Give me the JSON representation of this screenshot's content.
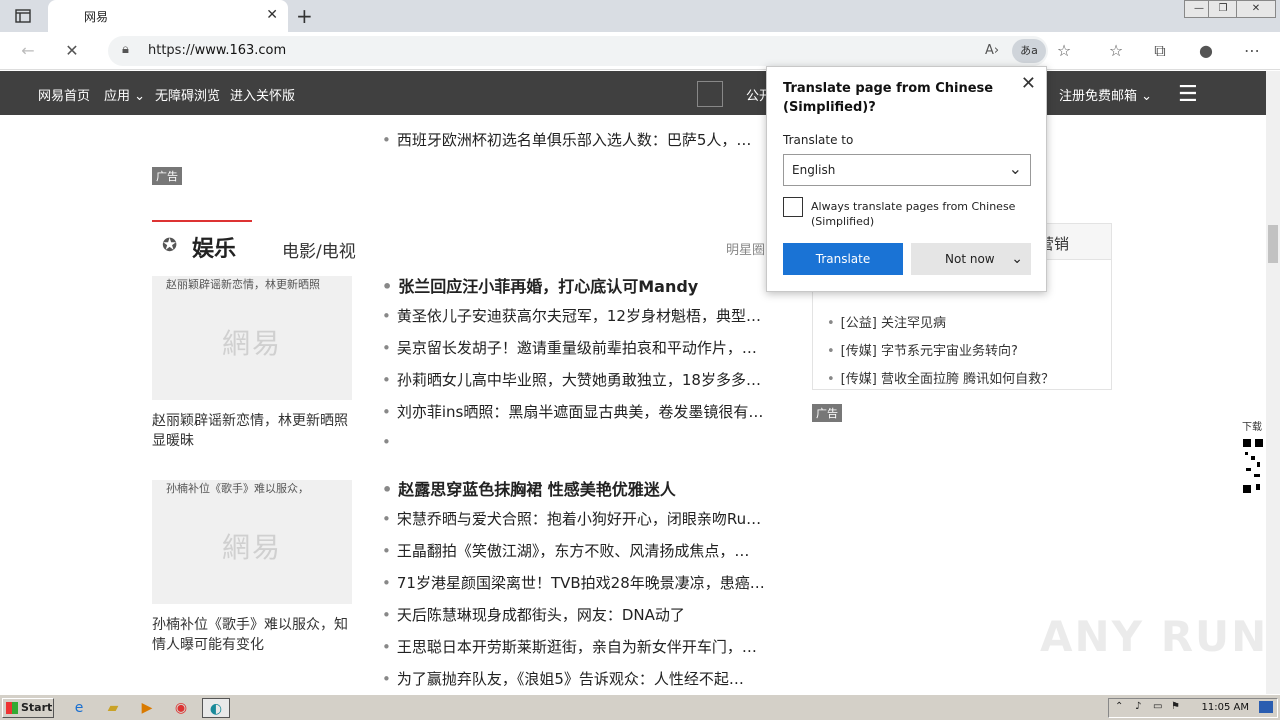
{
  "browser": {
    "tab_title": "网易",
    "url_prefix": "https://",
    "url_host": "www.163.com",
    "translate_pill": "あa"
  },
  "site_nav": {
    "home": "网易首页",
    "apps": "应用",
    "accessible": "无障碍浏览",
    "care": "进入关怀版",
    "public": "公开",
    "mail": "注册免费邮箱"
  },
  "top_news": "西班牙欧洲杯初选名单俱乐部入选人数：巴萨5人，…",
  "ad_label": "广告",
  "section": {
    "title": "娱乐",
    "sub": "电影/电视",
    "more": "明星圈"
  },
  "block1": {
    "img_alt": "赵丽颖辟谣新恋情，林更新晒照",
    "watermark": "網易",
    "caption": "赵丽颖辟谣新恋情，林更新晒照显暖昧",
    "headline": "张兰回应汪小菲再婚，打心底认可Mandy",
    "items": [
      "黄圣依儿子安迪获高尔夫冠军，12岁身材魁梧，典型…",
      "吴京留长发胡子！邀请重量级前辈拍哀和平动作片，…",
      "孙莉晒女儿高中毕业照，大赞她勇敢独立，18岁多多…",
      "刘亦菲ins晒照：黑扇半遮面显古典美，卷发墨镜很有…"
    ]
  },
  "block2": {
    "img_alt": "孙楠补位《歌手》难以服众，",
    "watermark": "網易",
    "caption": "孙楠补位《歌手》难以服众，知情人曝可能有变化",
    "headline": "赵露思穿蓝色抹胸裙 性感美艳优雅迷人",
    "items": [
      "宋慧乔晒与爱犬合照：抱着小狗好开心，闭眼亲吻Ru…",
      "王晶翻拍《笑傲江湖》，东方不败、风清扬成焦点，…",
      "71岁港星颜国梁离世！TVB拍戏28年晚景凄凉，患癌…",
      "天后陈慧琳现身成都街头，网友：DNA动了",
      "王思聪日本开劳斯莱斯逛街，亲自为新女伴开车门，…",
      "为了赢抛弃队友，《浪姐5》告诉观众：人性经不起…"
    ]
  },
  "side_box": {
    "header": "营销",
    "items": [
      "[公益] 关注罕见病",
      "[传媒] 字节系元宇宙业务转向?",
      "[传媒] 营收全面拉胯 腾讯如何自救？"
    ]
  },
  "right_edge": {
    "download": "下载"
  },
  "translate_popup": {
    "title": "Translate page from Chinese (Simplified)?",
    "translate_to_label": "Translate to",
    "language": "English",
    "always_label": "Always translate pages from Chinese (Simplified)",
    "always_checked": false,
    "translate_btn": "Translate",
    "not_now_btn": "Not now"
  },
  "taskbar": {
    "start": "Start",
    "clock": "11:05 AM"
  },
  "watermark": "ANY RUN"
}
